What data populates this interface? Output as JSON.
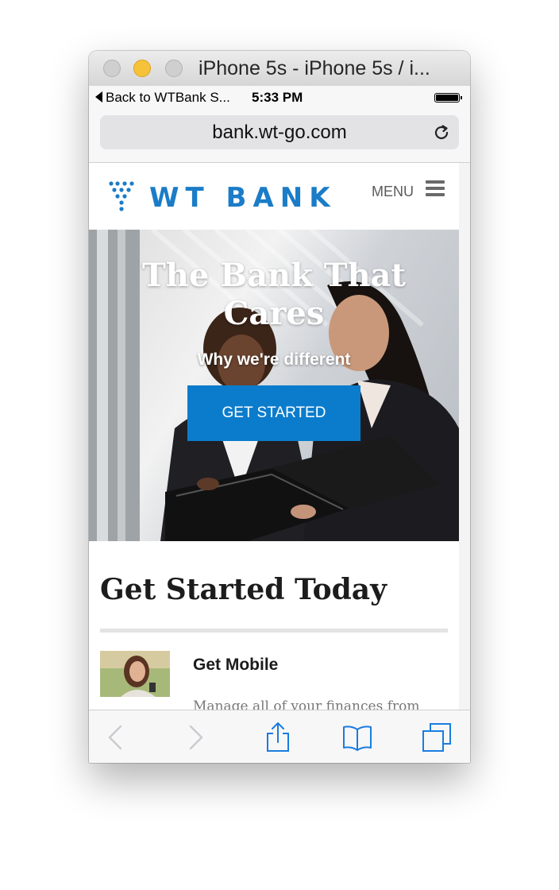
{
  "window": {
    "title": "iPhone 5s - iPhone 5s / i..."
  },
  "status_bar": {
    "back_label": "Back to WTBank S...",
    "time": "5:33 PM"
  },
  "browser": {
    "url": "bank.wt-go.com"
  },
  "site": {
    "logo_text": "WT BANK",
    "menu_label": "MENU",
    "hero": {
      "title": "The Bank That Cares",
      "subtitle": "Why we're different",
      "cta": "GET STARTED"
    },
    "section_title": "Get Started Today",
    "feature": {
      "title": "Get Mobile",
      "description": "Manage all of your finances from"
    }
  },
  "colors": {
    "brand_blue": "#1b7cc7",
    "cta_blue": "#0b7ccc",
    "ios_tint": "#1a7ce0"
  },
  "icons": [
    "reload-icon",
    "hamburger-icon",
    "back-icon",
    "forward-icon",
    "share-icon",
    "bookmarks-icon",
    "tabs-icon"
  ]
}
